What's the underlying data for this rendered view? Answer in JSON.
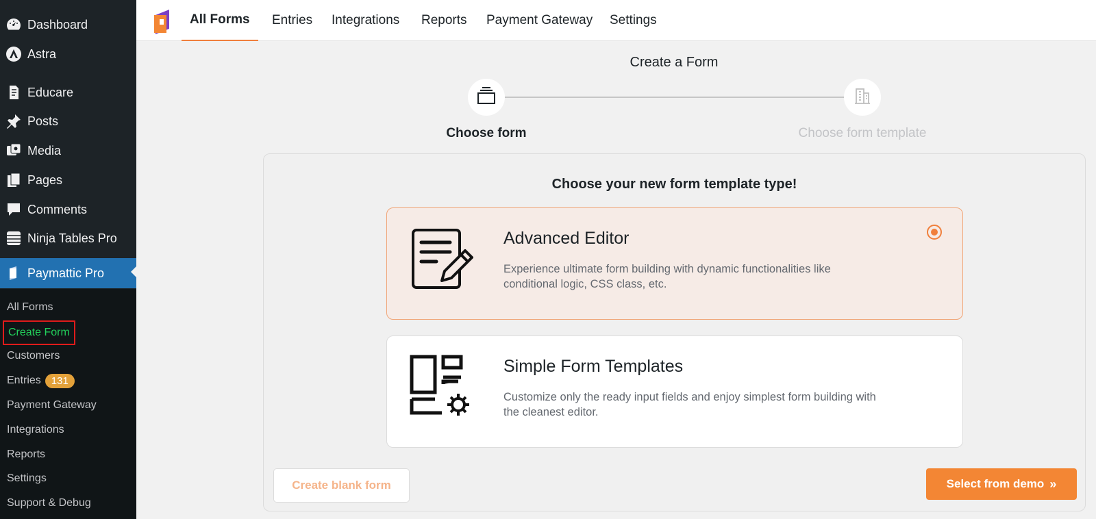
{
  "sidebar": {
    "items": [
      {
        "label": "Dashboard",
        "icon": "dashboard-icon"
      },
      {
        "label": "Astra",
        "icon": "astra-icon"
      },
      {
        "label": "Educare",
        "icon": "educare-icon"
      },
      {
        "label": "Posts",
        "icon": "pin-icon"
      },
      {
        "label": "Media",
        "icon": "media-icon"
      },
      {
        "label": "Pages",
        "icon": "pages-icon"
      },
      {
        "label": "Comments",
        "icon": "comment-icon"
      },
      {
        "label": "Ninja Tables Pro",
        "icon": "table-icon"
      },
      {
        "label": "Paymattic Pro",
        "icon": "paymattic-icon"
      }
    ],
    "submenu": [
      {
        "label": "All Forms"
      },
      {
        "label": "Create Form"
      },
      {
        "label": "Customers"
      },
      {
        "label": "Entries",
        "badge": "131"
      },
      {
        "label": "Payment Gateway"
      },
      {
        "label": "Integrations"
      },
      {
        "label": "Reports"
      },
      {
        "label": "Settings"
      },
      {
        "label": "Support & Debug"
      }
    ]
  },
  "topnav": {
    "tabs": [
      "All Forms",
      "Entries",
      "Integrations",
      "Reports",
      "Payment Gateway",
      "Settings"
    ],
    "active": "All Forms"
  },
  "stepper": {
    "title": "Create a Form",
    "steps": [
      {
        "label": "Choose form",
        "icon": "forms-stack-icon",
        "active": true
      },
      {
        "label": "Choose form template",
        "icon": "building-icon",
        "active": false
      }
    ]
  },
  "panel": {
    "title": "Choose your new form template type!",
    "cards": [
      {
        "title": "Advanced Editor",
        "desc": "Experience ultimate form building with dynamic functionalities like conditional logic, CSS class, etc.",
        "icon": "document-edit-icon",
        "selected": true
      },
      {
        "title": "Simple Form Templates",
        "desc": "Customize only the ready input fields and enjoy simplest form building with the cleanest editor.",
        "icon": "layout-gear-icon",
        "selected": false
      }
    ],
    "blank_button": "Create blank form",
    "demo_button": "Select from demo"
  },
  "colors": {
    "accent": "#f38634",
    "sidebar_bg": "#1d2327",
    "active_menu": "#2271b1",
    "current_submenu": "#22d15b"
  }
}
